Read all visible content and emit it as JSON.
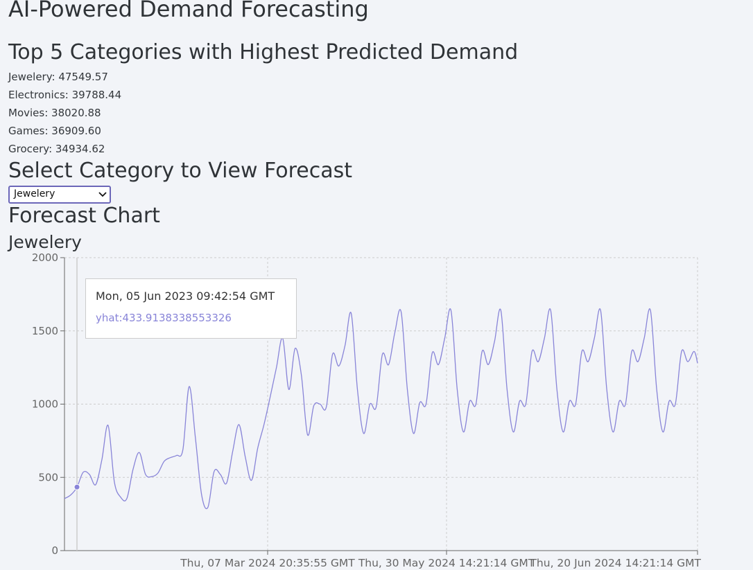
{
  "app": {
    "title": "AI-Powered Demand Forecasting"
  },
  "top5": {
    "title": "Top 5 Categories with Highest Predicted Demand",
    "items": [
      "Jewelery: 47549.57",
      "Electronics: 39788.44",
      "Movies: 38020.88",
      "Games: 36909.60",
      "Grocery: 34934.62"
    ]
  },
  "selector": {
    "title": "Select Category to View Forecast",
    "selected": "Jewelery"
  },
  "forecast": {
    "title": "Forecast Chart",
    "subtitle": "Jewelery"
  },
  "tooltip": {
    "label": "Mon, 05 Jun 2023 09:42:54 GMT",
    "value_text": "yhat:433.9138338553326"
  },
  "colors": {
    "line": "#8884d8",
    "grid": "#cccccc",
    "axis": "#666666",
    "select_border": "#6b66b8"
  },
  "chart_data": {
    "type": "line",
    "title": "Jewelery",
    "xlabel": "",
    "ylabel": "",
    "ylim": [
      0,
      2000
    ],
    "y_ticks": [
      0,
      500,
      1000,
      1500,
      2000
    ],
    "x_tick_labels": [
      "Thu, 07 Mar 2024 20:35:55 GMT",
      "Thu, 30 May 2024 14:21:14 GMT",
      "Thu, 20 Jun 2024 14:21:14 GMT"
    ],
    "grid": true,
    "legend": "none",
    "series": [
      {
        "x_index": [
          0,
          9,
          18,
          27,
          36,
          45,
          54,
          63,
          72,
          81,
          90,
          99,
          108,
          117,
          126,
          135,
          144,
          153,
          162,
          171,
          180,
          189,
          198,
          207,
          216,
          225,
          234,
          243,
          252,
          261,
          270,
          279,
          288,
          297,
          306,
          315,
          324,
          333,
          342,
          351,
          360,
          369,
          378,
          387,
          396,
          405,
          414,
          423,
          432,
          441,
          450,
          459,
          468,
          477,
          486,
          495,
          504,
          513,
          522,
          531,
          540,
          549,
          558,
          567,
          576,
          585,
          594,
          603,
          612,
          621,
          630,
          639,
          648,
          657,
          666,
          675,
          684,
          693,
          702,
          711,
          720,
          729,
          738,
          747,
          756,
          765,
          774,
          783,
          792,
          801,
          810,
          819,
          828,
          837,
          846,
          855,
          864,
          873,
          882,
          891,
          900,
          909,
          914
        ],
        "values": [
          355,
          380,
          433,
          535,
          520,
          450,
          620,
          855,
          470,
          365,
          355,
          555,
          670,
          520,
          505,
          530,
          610,
          635,
          650,
          690,
          1120,
          770,
          380,
          295,
          540,
          520,
          460,
          680,
          860,
          640,
          480,
          700,
          860,
          1050,
          1250,
          1450,
          1100,
          1380,
          1200,
          790,
          990,
          1000,
          980,
          1340,
          1260,
          1400,
          1620,
          1100,
          800,
          1000,
          980,
          1340,
          1270,
          1490,
          1630,
          1100,
          800,
          1010,
          1000,
          1350,
          1270,
          1450,
          1640,
          1100,
          810,
          1020,
          1000,
          1360,
          1270,
          1430,
          1640,
          1100,
          810,
          1020,
          1000,
          1360,
          1290,
          1450,
          1640,
          1100,
          810,
          1020,
          1000,
          1360,
          1290,
          1450,
          1640,
          1100,
          810,
          1020,
          1000,
          1360,
          1290,
          1450,
          1640,
          1100,
          810,
          1020,
          1000,
          1360,
          1290,
          1360,
          1280
        ]
      }
    ]
  }
}
